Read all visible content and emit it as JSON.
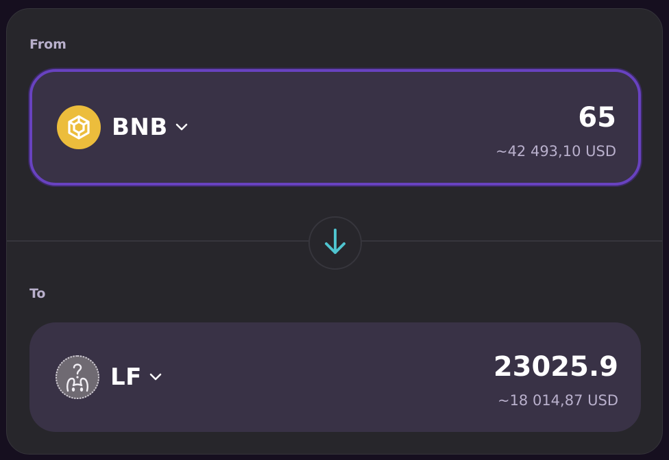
{
  "from": {
    "label": "From",
    "token": {
      "symbol": "BNB",
      "icon": "bnb-logo-icon"
    },
    "amount": "65",
    "usd": "~42 493,10 USD"
  },
  "to": {
    "label": "To",
    "token": {
      "symbol": "LF",
      "icon": "lf-logo-icon"
    },
    "amount": "23025.9",
    "usd": "~18 014,87 USD"
  },
  "swap_icon": "arrow-down-icon",
  "colors": {
    "accent_border": "#6842c0",
    "swap_arrow": "#4fc4cf",
    "bnb_yellow": "#ecbd3c"
  }
}
